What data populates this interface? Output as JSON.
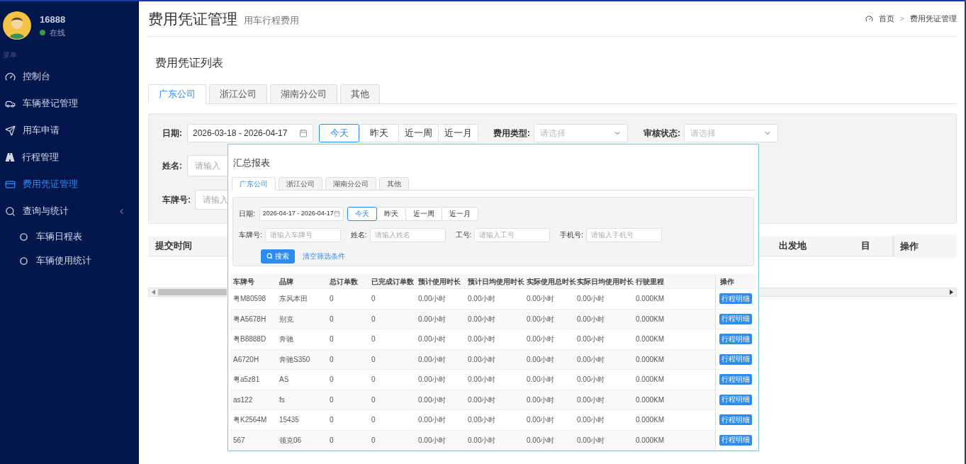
{
  "sidebar": {
    "user": {
      "name": "16888",
      "status": "在线"
    },
    "menu_label": "菜单",
    "items": [
      {
        "kind": "gauge",
        "label": "控制台",
        "selected": false
      },
      {
        "kind": "car",
        "label": "车辆登记管理",
        "selected": false
      },
      {
        "kind": "send",
        "label": "用车申请",
        "selected": false
      },
      {
        "kind": "road",
        "label": "行程管理",
        "selected": false
      },
      {
        "kind": "card",
        "label": "费用凭证管理",
        "selected": true
      },
      {
        "kind": "search",
        "label": "查询与统计",
        "selected": false,
        "children": [
          {
            "label": "车辆日程表"
          },
          {
            "label": "车辆使用统计"
          }
        ]
      }
    ]
  },
  "header": {
    "title": "费用凭证管理",
    "subtitle": "用车行程费用",
    "breadcrumb": [
      "首页",
      "费用凭证管理"
    ],
    "breadcrumb_separator": ">"
  },
  "list_title": "费用凭证列表",
  "tabs": [
    {
      "label": "广东公司",
      "selected": true
    },
    {
      "label": "浙江公司",
      "selected": false
    },
    {
      "label": "湖南分公司",
      "selected": false
    },
    {
      "label": "其他",
      "selected": false
    }
  ],
  "filters": {
    "date": {
      "label": "日期:",
      "value": "2026-03-18 - 2026-04-17"
    },
    "quick": [
      {
        "label": "今天",
        "selected": true
      },
      {
        "label": "昨天",
        "selected": false
      },
      {
        "label": "近一周",
        "selected": false
      },
      {
        "label": "近一月",
        "selected": false
      }
    ],
    "expense_type": {
      "label": "费用类型:",
      "placeholder": "请选择"
    },
    "review_status": {
      "label": "审核状态:",
      "placeholder": "请选择"
    },
    "name": {
      "label": "姓名:",
      "placeholder": "请输入"
    },
    "plate": {
      "label": "车牌号:",
      "placeholder": "请输入"
    }
  },
  "table": {
    "columns": [
      "提交时间",
      "出发地",
      "目",
      "操作"
    ]
  },
  "report": {
    "title": "汇总报表",
    "tabs": [
      {
        "label": "广东公司",
        "selected": true
      },
      {
        "label": "浙江公司",
        "selected": false
      },
      {
        "label": "湖南分公司",
        "selected": false
      },
      {
        "label": "其他",
        "selected": false
      }
    ],
    "date": {
      "label": "日期:",
      "value": "2026-04-17 - 2026-04-17"
    },
    "quick": [
      {
        "label": "今天",
        "selected": true
      },
      {
        "label": "昨天",
        "selected": false
      },
      {
        "label": "近一周",
        "selected": false
      },
      {
        "label": "近一月",
        "selected": false
      }
    ],
    "fields": [
      {
        "label": "车牌号:",
        "placeholder": "请输入车牌号"
      },
      {
        "label": "姓名:",
        "placeholder": "请输入姓名"
      },
      {
        "label": "工号:",
        "placeholder": "请输入工号"
      },
      {
        "label": "手机号:",
        "placeholder": "请输入手机号"
      }
    ],
    "search_button": "搜索",
    "clear_link": "清空筛选条件",
    "columns": [
      "车牌号",
      "品牌",
      "总订单数",
      "已完成订单数",
      "预计使用时长",
      "预计日均使用时长",
      "实际使用总时长",
      "实际日均使用时长",
      "行驶里程",
      "操作"
    ],
    "rows": [
      {
        "cells": [
          "粤M80598",
          "东风本田",
          "0",
          "0",
          "0.00小时",
          "0.00小时",
          "0.00小时",
          "0.00小时",
          "0.000KM"
        ],
        "action": "行程明细"
      },
      {
        "cells": [
          "粤A5678H",
          "别克",
          "0",
          "0",
          "0.00小时",
          "0.00小时",
          "0.00小时",
          "0.00小时",
          "0.000KM"
        ],
        "action": "行程明细"
      },
      {
        "cells": [
          "粤B8888D",
          "奔驰",
          "0",
          "0",
          "0.00小时",
          "0.00小时",
          "0.00小时",
          "0.00小时",
          "0.000KM"
        ],
        "action": "行程明细"
      },
      {
        "cells": [
          "A6720H",
          "奔驰S350",
          "0",
          "0",
          "0.00小时",
          "0.00小时",
          "0.00小时",
          "0.00小时",
          "0.000KM"
        ],
        "action": "行程明细"
      },
      {
        "cells": [
          "粤a5z81",
          "AS",
          "0",
          "0",
          "0.00小时",
          "0.00小时",
          "0.00小时",
          "0.00小时",
          "0.000KM"
        ],
        "action": "行程明细"
      },
      {
        "cells": [
          "as122",
          "fs",
          "0",
          "0",
          "0.00小时",
          "0.00小时",
          "0.00小时",
          "0.00小时",
          "0.000KM"
        ],
        "action": "行程明细"
      },
      {
        "cells": [
          "粤K2564M",
          "15435",
          "0",
          "0",
          "0.00小时",
          "0.00小时",
          "0.00小时",
          "0.00小时",
          "0.000KM"
        ],
        "action": "行程明细"
      },
      {
        "cells": [
          "567",
          "领克06",
          "0",
          "0",
          "0.00小时",
          "0.00小时",
          "0.00小时",
          "0.00小时",
          "0.000KM"
        ],
        "action": "行程明细"
      }
    ]
  }
}
